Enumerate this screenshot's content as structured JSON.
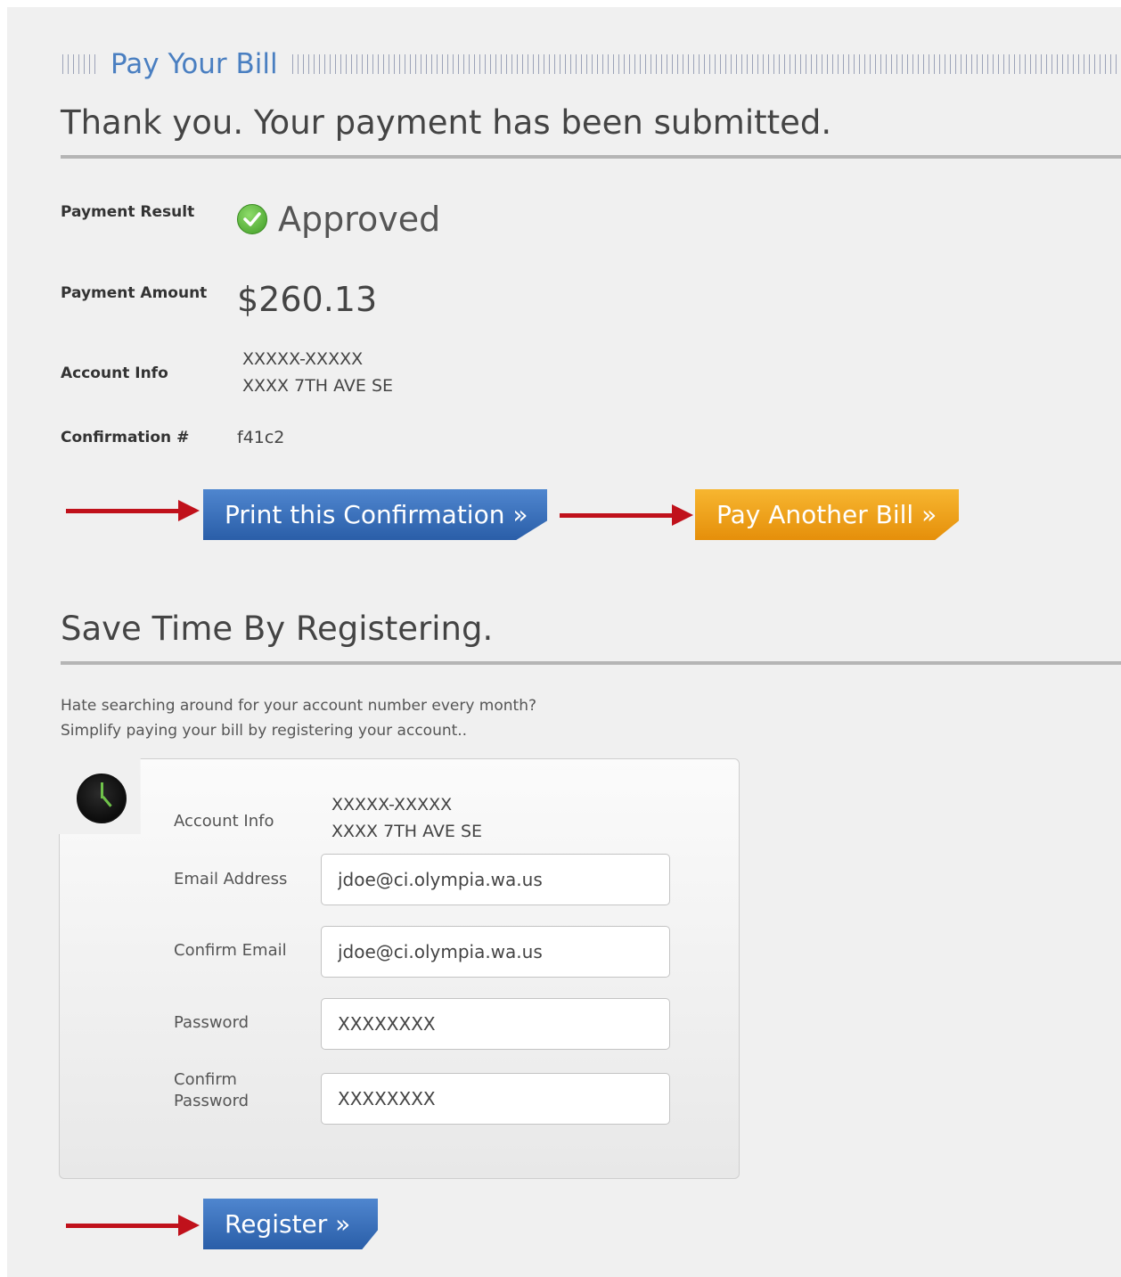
{
  "header": {
    "section_label": "Pay Your Bill"
  },
  "confirmation": {
    "headline": "Thank you. Your payment has been submitted.",
    "payment_result_label": "Payment Result",
    "payment_result_value": "Approved",
    "payment_amount_label": "Payment Amount",
    "payment_amount_value": "$260.13",
    "account_info_label": "Account Info",
    "account_number": "XXXXX-XXXXX",
    "account_address": "XXXX 7TH AVE SE",
    "confirmation_label": "Confirmation #",
    "confirmation_value": "f41c2"
  },
  "actions": {
    "print_label": "Print this Confirmation »",
    "pay_another_label": "Pay Another Bill »"
  },
  "register": {
    "title": "Save Time By Registering.",
    "promo_line1": "Hate searching around for your account number every month?",
    "promo_line2": "Simplify paying your bill by registering your account..",
    "account_info_label": "Account Info",
    "account_number": "XXXXX-XXXXX",
    "account_address": "XXXX 7TH AVE SE",
    "email_label": "Email Address",
    "email_value": "jdoe@ci.olympia.wa.us",
    "confirm_email_label": "Confirm Email",
    "confirm_email_value": "jdoe@ci.olympia.wa.us",
    "password_label": "Password",
    "password_value": "XXXXXXXX",
    "confirm_password_label_line1": "Confirm",
    "confirm_password_label_line2": "Password",
    "confirm_password_value": "XXXXXXXX",
    "register_label": "Register »"
  },
  "colors": {
    "accent_blue": "#4a7fc1",
    "button_orange": "#f0a21e",
    "arrow_red": "#c0111b",
    "approved_green": "#4caf30"
  }
}
